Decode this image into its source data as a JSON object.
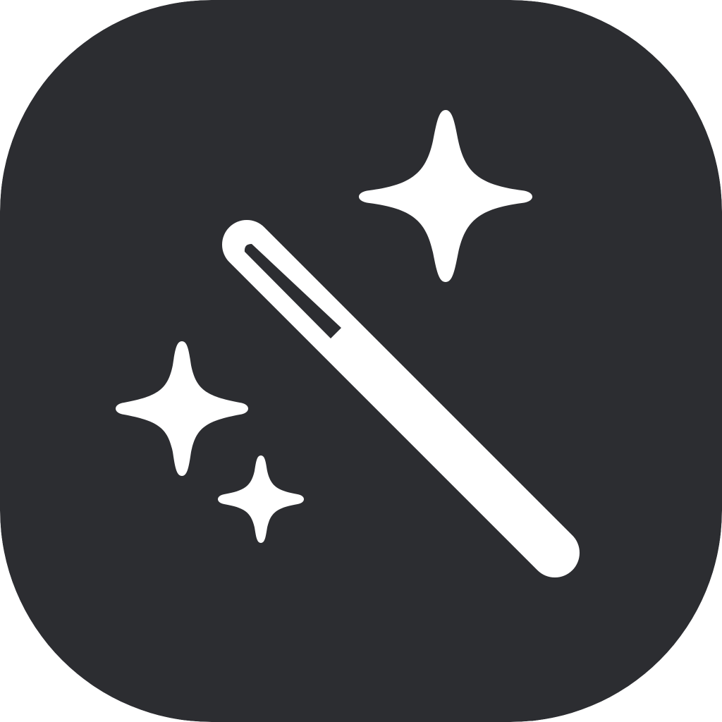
{
  "icon": {
    "subject": "magic-wand-with-sparkles",
    "glyph_name": "magic-wand-icon",
    "colors": {
      "background": "#2c2d31",
      "glyph": "#ffffff"
    },
    "sparkles": [
      "sparkle-large-icon",
      "sparkle-medium-icon",
      "sparkle-small-icon"
    ]
  }
}
